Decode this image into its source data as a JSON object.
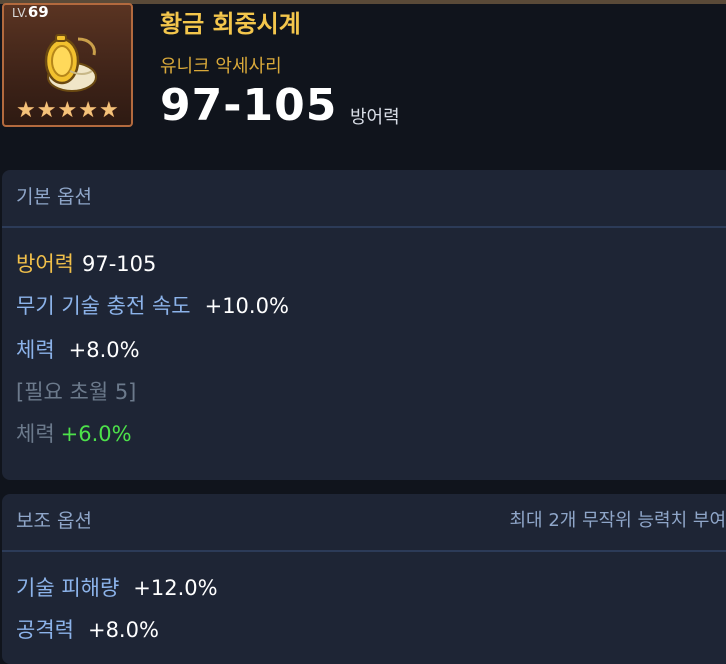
{
  "item": {
    "level_label": "LV.",
    "level": "69",
    "name": "황금 회중시계",
    "type": "유니크 악세사리",
    "main_stat_value": "97-105",
    "main_stat_label": "방어력",
    "stars": [
      "★",
      "★",
      "★",
      "★",
      "★"
    ],
    "icon": "golden-pocket-watch-icon"
  },
  "basic": {
    "title": "기본 옵션",
    "options": [
      {
        "key": "방어력",
        "value": "97-105"
      },
      {
        "key": "무기 기술 충전 속도",
        "value": "+10.0%"
      },
      {
        "key": "체력",
        "value": "+8.0%"
      }
    ],
    "requirement": "[필요 초월 5]",
    "locked_option": {
      "key": "체력",
      "value": "+6.0%"
    }
  },
  "sub": {
    "title": "보조 옵션",
    "note": "최대 2개 무작위 능력치 부여",
    "options": [
      {
        "key": "기술 피해량",
        "value": "+12.0%"
      },
      {
        "key": "공격력",
        "value": "+8.0%"
      }
    ]
  },
  "colors": {
    "gold": "#f3c64c",
    "stat_key": "#8cb3ea",
    "bonus_green": "#4de14a",
    "panel_bg": "#1e2535"
  }
}
